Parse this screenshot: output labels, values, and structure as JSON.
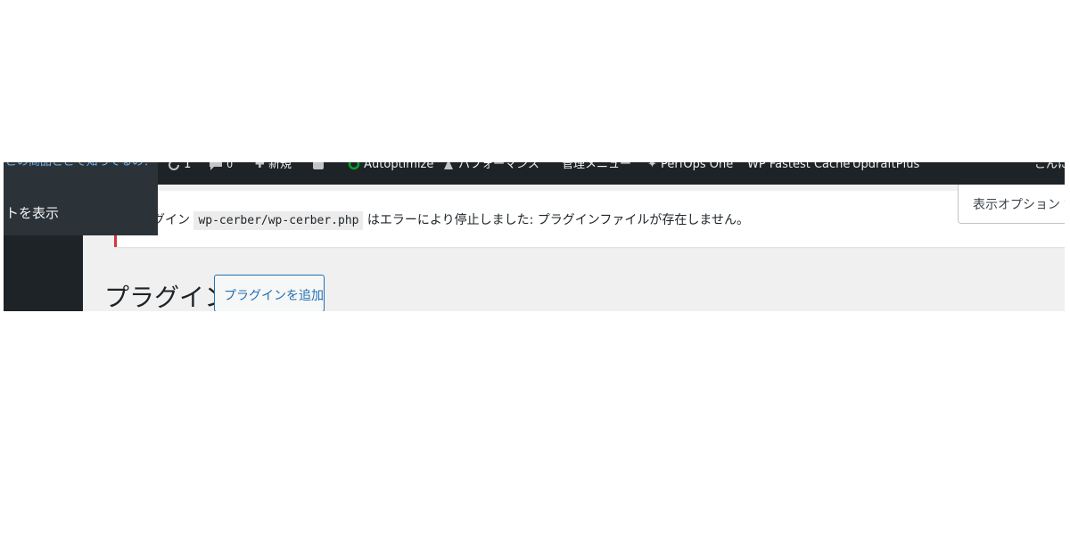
{
  "admin_bar": {
    "updates_count": "1",
    "comments_count": "0",
    "new_label": "新規",
    "autoptimize_label": "Autoptimize",
    "performance_label": "パフォーマンス",
    "admin_menu_label": "管理メニュー",
    "perfops_label": "PerfOps One",
    "fastest_cache_label": "WP Fastest Cache",
    "updraft_label": "UpdraftPlus",
    "howdy_label": "こんに"
  },
  "flyout": {
    "question_text": "この商品どこで知ってるの？",
    "show_site_label": "トを表示"
  },
  "notice": {
    "prefix": "グイン",
    "plugin_path": "wp-cerber/wp-cerber.php",
    "message": "はエラーにより停止しました: プラグインファイルが存在しません。"
  },
  "screen_options": {
    "label": "表示オプション ▼"
  },
  "page": {
    "title": "プラグイン",
    "add_button_label": "プラグインを追加"
  },
  "colors": {
    "admin_bar_bg": "#1d2327",
    "link": "#2271b1",
    "error": "#d63638",
    "autoptimize_green": "#00a32a"
  }
}
